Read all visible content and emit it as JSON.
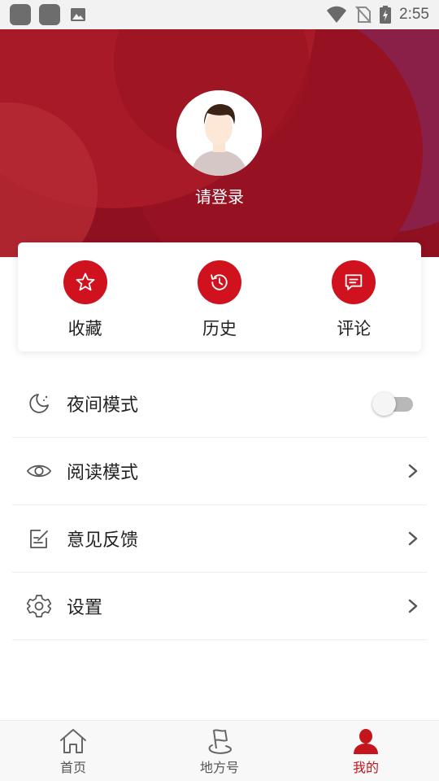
{
  "status_bar": {
    "time": "2:55"
  },
  "profile": {
    "login_text": "请登录"
  },
  "shortcuts": [
    {
      "label": "收藏",
      "icon": "star-icon"
    },
    {
      "label": "历史",
      "icon": "history-icon"
    },
    {
      "label": "评论",
      "icon": "comment-icon"
    }
  ],
  "menu": [
    {
      "label": "夜间模式",
      "icon": "moon-icon",
      "control": "toggle",
      "toggle_on": false
    },
    {
      "label": "阅读模式",
      "icon": "eye-icon",
      "control": "chevron"
    },
    {
      "label": "意见反馈",
      "icon": "feedback-icon",
      "control": "chevron"
    },
    {
      "label": "设置",
      "icon": "gear-icon",
      "control": "chevron"
    }
  ],
  "tabs": [
    {
      "label": "首页",
      "icon": "home-icon",
      "active": false
    },
    {
      "label": "地方号",
      "icon": "flag-icon",
      "active": false
    },
    {
      "label": "我的",
      "icon": "person-icon",
      "active": true
    }
  ],
  "colors": {
    "accent": "#d0121e",
    "header": "#9c1623",
    "active_tab": "#c4151c"
  }
}
